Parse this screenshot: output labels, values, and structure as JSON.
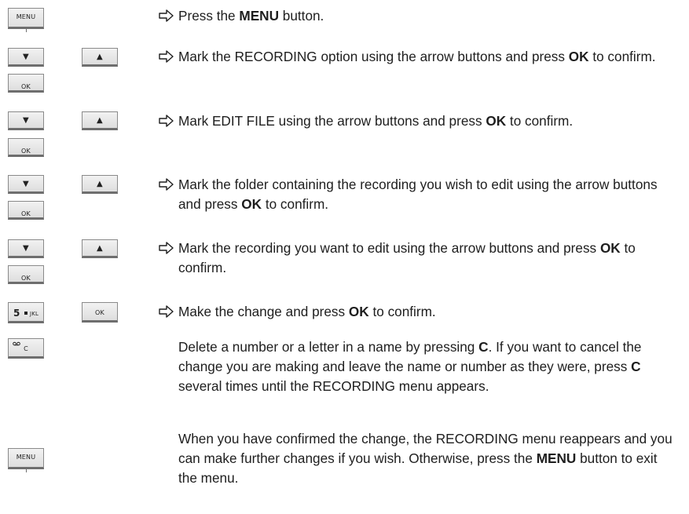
{
  "keys": {
    "menu": "MENU",
    "down": "▼",
    "up": "▲",
    "ok": "OK",
    "five_digit": "5",
    "five_letters": "JKL",
    "clear": "C"
  },
  "steps": [
    {
      "a": "Press the ",
      "b": "MENU",
      "c": " button."
    },
    {
      "a": "Mark the RECORDING option using the arrow buttons and press ",
      "b": "OK",
      "c": " to confirm."
    },
    {
      "a": "Mark EDIT FILE using the arrow buttons and press ",
      "b": "OK",
      "c": " to confirm."
    },
    {
      "a": "Mark the folder containing the recording you wish to edit using the arrow buttons and press ",
      "b": "OK",
      "c": " to confirm."
    },
    {
      "a": "Mark the recording you want to edit using the arrow buttons and press ",
      "b": "OK",
      "c": " to confirm."
    },
    {
      "a": "Make the change and press ",
      "b": "OK",
      "c": " to confirm."
    }
  ],
  "para1": {
    "a": "Delete a number or a letter in a name by pressing ",
    "b": "C",
    "c": ". If you want to cancel the change you are making and leave the name or number as they were, press ",
    "d": "C",
    "e": " several times until the RECORDING menu appears."
  },
  "para2": {
    "a": "When you have confirmed the change, the RECORDING menu reappears and you can make further changes if you wish. Otherwise, press the ",
    "b": "MENU",
    "c": " button to exit the menu."
  }
}
